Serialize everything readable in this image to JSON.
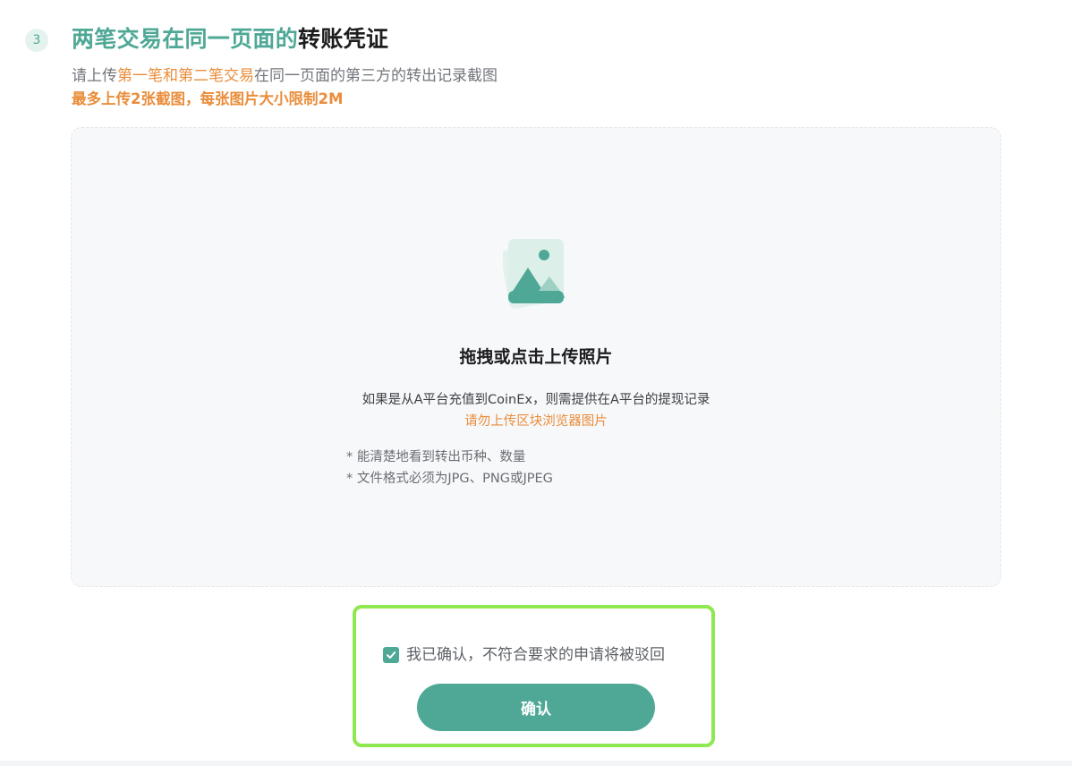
{
  "step": {
    "number": "3",
    "title_highlight": "两笔交易在同一页面的",
    "title_rest": "转账凭证"
  },
  "description": {
    "line1_prefix": "请上传",
    "line1_highlight": "第一笔和第二笔交易",
    "line1_suffix": "在同一页面的第三方的转出记录截图",
    "line2": "最多上传2张截图，每张图片大小限制2M"
  },
  "upload": {
    "icon": "image-icon",
    "title": "拖拽或点击上传照片",
    "hint": "如果是从A平台充值到CoinEx，则需提供在A平台的提现记录",
    "warning": "请勿上传区块浏览器图片",
    "requirements": [
      "* 能清楚地看到转出币种、数量",
      "* 文件格式必须为JPG、PNG或JPEG"
    ]
  },
  "confirm": {
    "checkbox_checked": true,
    "checkbox_label": "我已确认，不符合要求的申请将被驳回",
    "button_label": "确认"
  },
  "colors": {
    "accent": "#4fa896",
    "warning": "#ea8d3b",
    "highlight_border": "#8ee84f"
  }
}
